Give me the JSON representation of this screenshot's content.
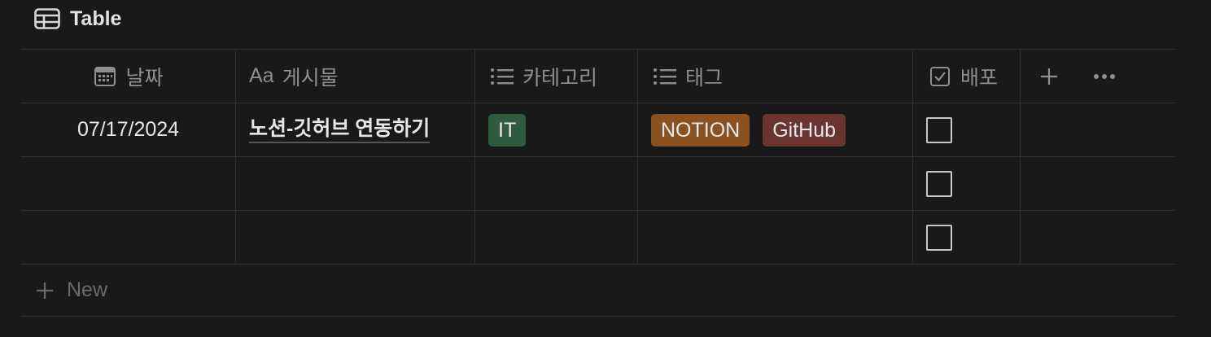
{
  "view": {
    "title": "Table",
    "icon": "table-icon"
  },
  "columns": [
    {
      "key": "date",
      "label": "날짜",
      "icon": "calendar-icon"
    },
    {
      "key": "post",
      "label": "게시물",
      "icon_text": "Aa"
    },
    {
      "key": "category",
      "label": "카테고리",
      "icon": "list-icon"
    },
    {
      "key": "tags",
      "label": "태그",
      "icon": "list-icon"
    },
    {
      "key": "deploy",
      "label": "배포",
      "icon": "checkbox-icon"
    }
  ],
  "rows": [
    {
      "date": "07/17/2024",
      "post": "노션-깃허브 연동하기",
      "category": {
        "label": "IT",
        "color": "#2f5b3f"
      },
      "tags": [
        {
          "label": "NOTION",
          "color": "#8a5220"
        },
        {
          "label": "GitHub",
          "color": "#6a3431"
        }
      ],
      "deploy": false
    },
    {
      "date": "",
      "post": "",
      "deploy": false
    },
    {
      "date": "",
      "post": "",
      "deploy": false
    }
  ],
  "new_row_label": "New"
}
